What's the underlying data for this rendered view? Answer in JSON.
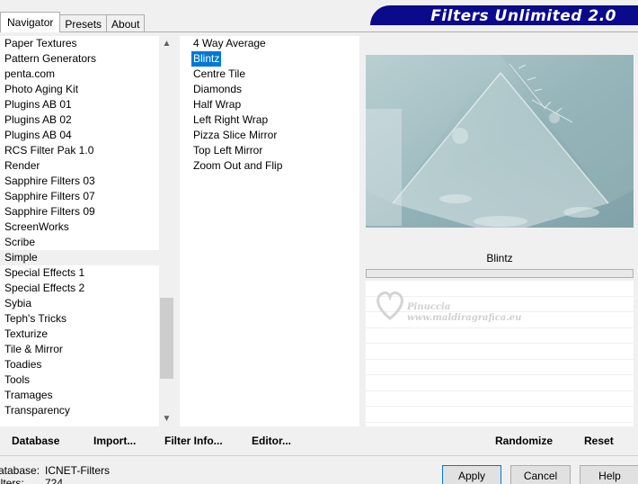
{
  "banner": {
    "title": "Filters Unlimited 2.0"
  },
  "tabs": [
    {
      "label": "Navigator"
    },
    {
      "label": "Presets"
    },
    {
      "label": "About"
    }
  ],
  "categories": [
    "Paper Textures",
    "Pattern Generators",
    "penta.com",
    "Photo Aging Kit",
    "Plugins AB 01",
    "Plugins AB 02",
    "Plugins AB 04",
    "RCS Filter Pak 1.0",
    "Render",
    "Sapphire Filters 03",
    "Sapphire Filters 07",
    "Sapphire Filters 09",
    "ScreenWorks",
    "Scribe",
    "Simple",
    "Special Effects 1",
    "Special Effects 2",
    "Sybia",
    "Teph's Tricks",
    "Texturize",
    "Tile & Mirror",
    "Toadies",
    "Tools",
    "Tramages",
    "Transparency"
  ],
  "selected_category": "Simple",
  "filters": [
    "4 Way Average",
    "Blintz",
    "Centre Tile",
    "Diamonds",
    "Half Wrap",
    "Left Right Wrap",
    "Pizza Slice Mirror",
    "Top Left Mirror",
    "Zoom Out and Flip"
  ],
  "selected_filter": "Blintz",
  "filter_name": "Blintz",
  "watermark": {
    "line1": "Pinuccia",
    "line2": "www.maldiragrafica.eu"
  },
  "bottom_buttons": {
    "database": "Database",
    "import": "Import...",
    "filter_info": "Filter Info...",
    "editor": "Editor...",
    "randomize": "Randomize",
    "reset": "Reset"
  },
  "info": {
    "database_label": "atabase:",
    "database_value": "ICNET-Filters",
    "filters_label": "ilters:",
    "filters_value": "724"
  },
  "dialog_buttons": {
    "apply": "Apply",
    "cancel": "Cancel",
    "help": "Help"
  },
  "colors": {
    "banner": "#0a0a8c",
    "selection": "#0078d7"
  }
}
